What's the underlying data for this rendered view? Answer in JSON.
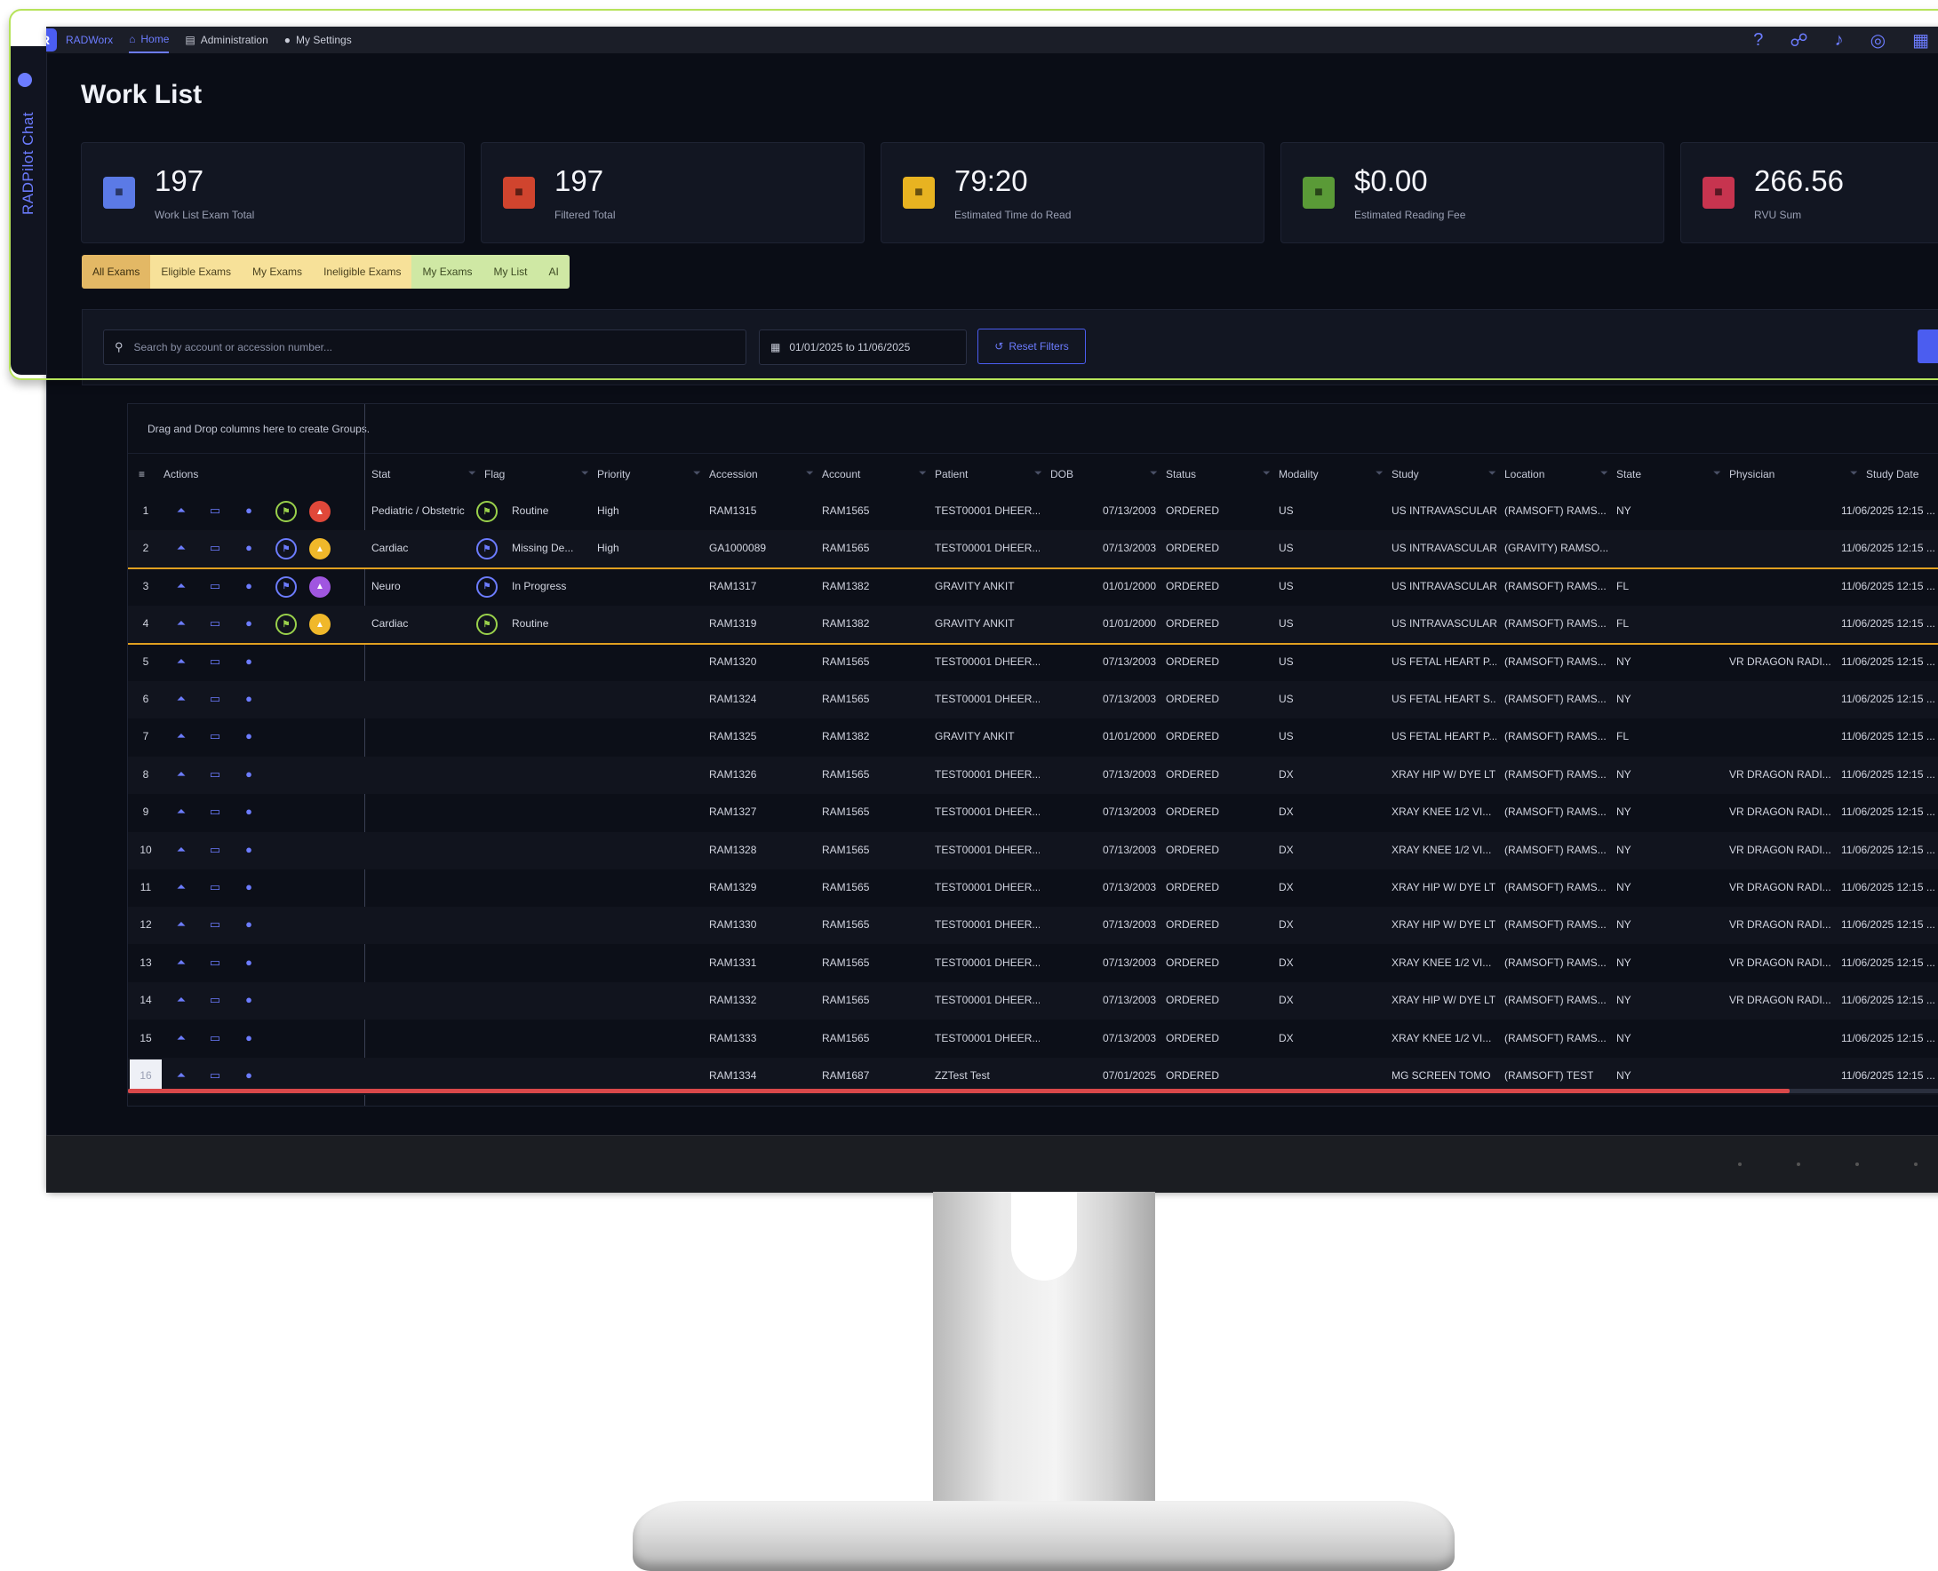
{
  "nav": {
    "brand": "RADWorx",
    "home": "Home",
    "administration": "Administration",
    "settings": "My Settings",
    "right_icons": [
      "help-icon",
      "user-connect-icon",
      "bell-icon",
      "headset-icon",
      "apps-icon"
    ]
  },
  "chat_rail": {
    "label": "RADPilot Chat"
  },
  "page": {
    "title": "Work List"
  },
  "stats": [
    {
      "value": "197",
      "label": "Work List Exam Total",
      "color": "#5b7ae6",
      "icon": "list-icon"
    },
    {
      "value": "197",
      "label": "Filtered Total",
      "color": "#d0442e",
      "icon": "filter-icon"
    },
    {
      "value": "79:20",
      "label": "Estimated Time do Read",
      "color": "#e8b321",
      "icon": "clock-icon"
    },
    {
      "value": "$0.00",
      "label": "Estimated Reading Fee",
      "color": "#5a9a37",
      "icon": "money-icon"
    },
    {
      "value": "266.56",
      "label": "RVU Sum",
      "color": "#c7344f",
      "icon": "rvu-icon"
    }
  ],
  "tabs": [
    "All Exams",
    "Eligible Exams",
    "My Exams",
    "Ineligible Exams",
    "My Exams",
    "My List",
    "AI"
  ],
  "filters": {
    "search_placeholder": "Search by account or accession number...",
    "date_range": "01/01/2025 to 11/06/2025",
    "reset_label": "Reset Filters"
  },
  "grid": {
    "group_hint": "Drag and Drop columns here to create Groups.",
    "columns": [
      "Actions",
      "Stat",
      "Flag",
      "Priority",
      "Accession",
      "Account",
      "Patient",
      "DOB",
      "Status",
      "Modality",
      "Study",
      "Location",
      "State",
      "Physician",
      "Study Date"
    ],
    "rows": [
      {
        "n": "1",
        "stat": "Pediatric / Obstetric",
        "flag": "Routine",
        "priority": "High",
        "acc": "RAM1315",
        "account": "RAM1565",
        "patient": "TEST00001 DHEER...",
        "dob": "07/13/2003",
        "status": "ORDERED",
        "mod": "US",
        "study": "US INTRAVASCULAR",
        "loc": "(RAMSOFT) RAMS...",
        "state": "NY",
        "phys": "",
        "date": "11/06/2025 12:15 ...",
        "line": "#d0442e",
        "badge": "#e0483a",
        "flagc": "#9ad14b",
        "extra": true
      },
      {
        "n": "2",
        "stat": "Cardiac",
        "flag": "Missing De...",
        "priority": "High",
        "acc": "GA1000089",
        "account": "RAM1565",
        "patient": "TEST00001 DHEER...",
        "dob": "07/13/2003",
        "status": "ORDERED",
        "mod": "US",
        "study": "US INTRAVASCULAR",
        "loc": "(GRAVITY) RAMSO...",
        "state": "",
        "phys": "",
        "date": "11/06/2025 12:15 ...",
        "line": "#e0a020",
        "badge": "#f0b82a",
        "flagc": "#6c7cff",
        "extra": true
      },
      {
        "n": "3",
        "stat": "Neuro",
        "flag": "In Progress",
        "priority": "",
        "acc": "RAM1317",
        "account": "RAM1382",
        "patient": "GRAVITY ANKIT",
        "dob": "01/01/2000",
        "status": "ORDERED",
        "mod": "US",
        "study": "US INTRAVASCULAR",
        "loc": "(RAMSOFT) RAMS...",
        "state": "FL",
        "phys": "",
        "date": "11/06/2025 12:15 ...",
        "line": "#8e3fd6",
        "badge": "#a056e0",
        "flagc": "#6c7cff",
        "extra": true
      },
      {
        "n": "4",
        "stat": "Cardiac",
        "flag": "Routine",
        "priority": "",
        "acc": "RAM1319",
        "account": "RAM1382",
        "patient": "GRAVITY ANKIT",
        "dob": "01/01/2000",
        "status": "ORDERED",
        "mod": "US",
        "study": "US INTRAVASCULAR",
        "loc": "(RAMSOFT) RAMS...",
        "state": "FL",
        "phys": "",
        "date": "11/06/2025 12:15 ...",
        "line": "#e0a020",
        "badge": "#f0b82a",
        "flagc": "#9ad14b",
        "extra": true
      },
      {
        "n": "5",
        "stat": "",
        "flag": "",
        "priority": "",
        "acc": "RAM1320",
        "account": "RAM1565",
        "patient": "TEST00001 DHEER...",
        "dob": "07/13/2003",
        "status": "ORDERED",
        "mod": "US",
        "study": "US FETAL HEART P...",
        "loc": "(RAMSOFT) RAMS...",
        "state": "NY",
        "phys": "VR DRAGON RADI...",
        "date": "11/06/2025 12:15 ..."
      },
      {
        "n": "6",
        "stat": "",
        "flag": "",
        "priority": "",
        "acc": "RAM1324",
        "account": "RAM1565",
        "patient": "TEST00001 DHEER...",
        "dob": "07/13/2003",
        "status": "ORDERED",
        "mod": "US",
        "study": "US FETAL HEART S...",
        "loc": "(RAMSOFT) RAMS...",
        "state": "NY",
        "phys": "",
        "date": "11/06/2025 12:15 ..."
      },
      {
        "n": "7",
        "stat": "",
        "flag": "",
        "priority": "",
        "acc": "RAM1325",
        "account": "RAM1382",
        "patient": "GRAVITY ANKIT",
        "dob": "01/01/2000",
        "status": "ORDERED",
        "mod": "US",
        "study": "US FETAL HEART P...",
        "loc": "(RAMSOFT) RAMS...",
        "state": "FL",
        "phys": "",
        "date": "11/06/2025 12:15 ..."
      },
      {
        "n": "8",
        "stat": "",
        "flag": "",
        "priority": "",
        "acc": "RAM1326",
        "account": "RAM1565",
        "patient": "TEST00001 DHEER...",
        "dob": "07/13/2003",
        "status": "ORDERED",
        "mod": "DX",
        "study": "XRAY HIP W/ DYE LT",
        "loc": "(RAMSOFT) RAMS...",
        "state": "NY",
        "phys": "VR DRAGON RADI...",
        "date": "11/06/2025 12:15 ..."
      },
      {
        "n": "9",
        "stat": "",
        "flag": "",
        "priority": "",
        "acc": "RAM1327",
        "account": "RAM1565",
        "patient": "TEST00001 DHEER...",
        "dob": "07/13/2003",
        "status": "ORDERED",
        "mod": "DX",
        "study": "XRAY KNEE 1/2 VI...",
        "loc": "(RAMSOFT) RAMS...",
        "state": "NY",
        "phys": "VR DRAGON RADI...",
        "date": "11/06/2025 12:15 ..."
      },
      {
        "n": "10",
        "stat": "",
        "flag": "",
        "priority": "",
        "acc": "RAM1328",
        "account": "RAM1565",
        "patient": "TEST00001 DHEER...",
        "dob": "07/13/2003",
        "status": "ORDERED",
        "mod": "DX",
        "study": "XRAY KNEE 1/2 VI...",
        "loc": "(RAMSOFT) RAMS...",
        "state": "NY",
        "phys": "VR DRAGON RADI...",
        "date": "11/06/2025 12:15 ..."
      },
      {
        "n": "11",
        "stat": "",
        "flag": "",
        "priority": "",
        "acc": "RAM1329",
        "account": "RAM1565",
        "patient": "TEST00001 DHEER...",
        "dob": "07/13/2003",
        "status": "ORDERED",
        "mod": "DX",
        "study": "XRAY HIP W/ DYE LT",
        "loc": "(RAMSOFT) RAMS...",
        "state": "NY",
        "phys": "VR DRAGON RADI...",
        "date": "11/06/2025 12:15 ..."
      },
      {
        "n": "12",
        "stat": "",
        "flag": "",
        "priority": "",
        "acc": "RAM1330",
        "account": "RAM1565",
        "patient": "TEST00001 DHEER...",
        "dob": "07/13/2003",
        "status": "ORDERED",
        "mod": "DX",
        "study": "XRAY HIP W/ DYE LT",
        "loc": "(RAMSOFT) RAMS...",
        "state": "NY",
        "phys": "VR DRAGON RADI...",
        "date": "11/06/2025 12:15 ..."
      },
      {
        "n": "13",
        "stat": "",
        "flag": "",
        "priority": "",
        "acc": "RAM1331",
        "account": "RAM1565",
        "patient": "TEST00001 DHEER...",
        "dob": "07/13/2003",
        "status": "ORDERED",
        "mod": "DX",
        "study": "XRAY KNEE 1/2 VI...",
        "loc": "(RAMSOFT) RAMS...",
        "state": "NY",
        "phys": "VR DRAGON RADI...",
        "date": "11/06/2025 12:15 ..."
      },
      {
        "n": "14",
        "stat": "",
        "flag": "",
        "priority": "",
        "acc": "RAM1332",
        "account": "RAM1565",
        "patient": "TEST00001 DHEER...",
        "dob": "07/13/2003",
        "status": "ORDERED",
        "mod": "DX",
        "study": "XRAY HIP W/ DYE LT",
        "loc": "(RAMSOFT) RAMS...",
        "state": "NY",
        "phys": "VR DRAGON RADI...",
        "date": "11/06/2025 12:15 ..."
      },
      {
        "n": "15",
        "stat": "",
        "flag": "",
        "priority": "",
        "acc": "RAM1333",
        "account": "RAM1565",
        "patient": "TEST00001 DHEER...",
        "dob": "07/13/2003",
        "status": "ORDERED",
        "mod": "DX",
        "study": "XRAY KNEE 1/2 VI...",
        "loc": "(RAMSOFT) RAMS...",
        "state": "NY",
        "phys": "",
        "date": "11/06/2025 12:15 ..."
      },
      {
        "n": "16",
        "stat": "",
        "flag": "",
        "priority": "",
        "acc": "RAM1334",
        "account": "RAM1687",
        "patient": "ZZTest Test",
        "dob": "07/01/2025",
        "status": "ORDERED",
        "mod": "",
        "study": "MG SCREEN TOMO",
        "loc": "(RAMSOFT) TEST",
        "state": "NY",
        "phys": "",
        "date": "11/06/2025 12:15 ..."
      }
    ]
  },
  "colors": {
    "accent": "#6c7cff",
    "callout_border": "#b6e35a",
    "scroll_thumb": "#d9484a"
  }
}
